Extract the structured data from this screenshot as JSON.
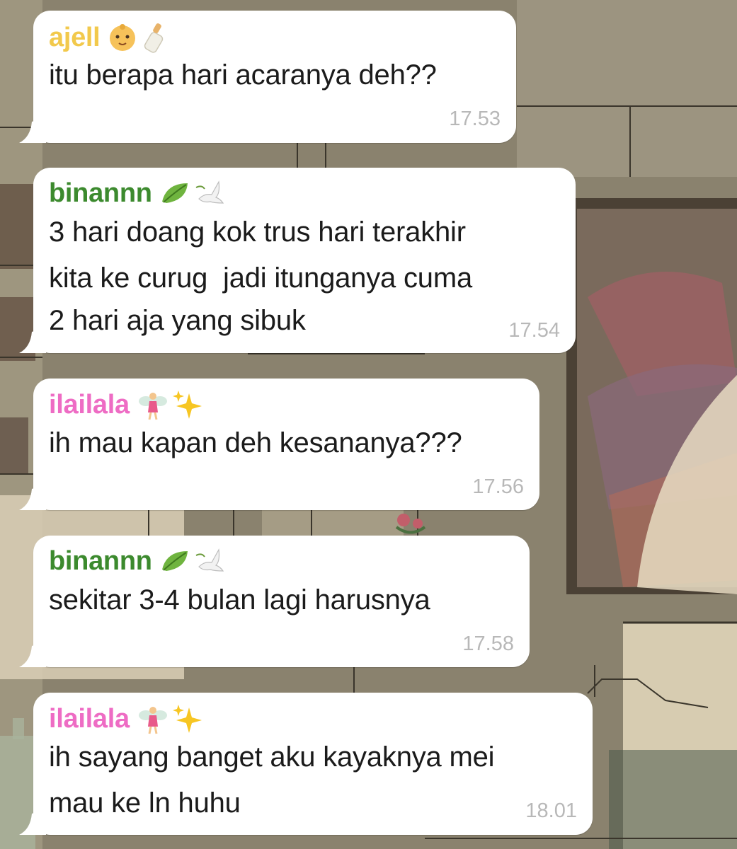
{
  "colors": {
    "ajell": "#f2c94c",
    "binannn": "#3c8a2e",
    "ilailala": "#ee6cc4",
    "bubble": "#ffffff",
    "timestamp": "#b8b8b8",
    "message_text": "#1b1b1b"
  },
  "messages": [
    {
      "sender": "ajell",
      "sender_icons": [
        "baby-face-icon",
        "baby-bottle-icon"
      ],
      "lines": [
        "itu berapa hari acaranya deh??"
      ],
      "time": "17.53"
    },
    {
      "sender": "binannn",
      "sender_icons": [
        "leaf-icon",
        "dove-icon"
      ],
      "lines": [
        "3 hari doang kok trus hari terakhir",
        "kita ke curug  jadi itunganya cuma",
        "2 hari aja yang sibuk"
      ],
      "time": "17.54"
    },
    {
      "sender": "ilailala",
      "sender_icons": [
        "fairy-icon",
        "sparkles-icon"
      ],
      "lines": [
        "ih mau kapan deh kesananya???"
      ],
      "time": "17.56"
    },
    {
      "sender": "binannn",
      "sender_icons": [
        "leaf-icon",
        "dove-icon"
      ],
      "lines": [
        "sekitar 3-4 bulan lagi harusnya"
      ],
      "time": "17.58"
    },
    {
      "sender": "ilailala",
      "sender_icons": [
        "fairy-icon",
        "sparkles-icon"
      ],
      "lines": [
        "ih sayang banget aku kayaknya mei",
        "mau ke ln huhu"
      ],
      "time": "18.01"
    }
  ]
}
